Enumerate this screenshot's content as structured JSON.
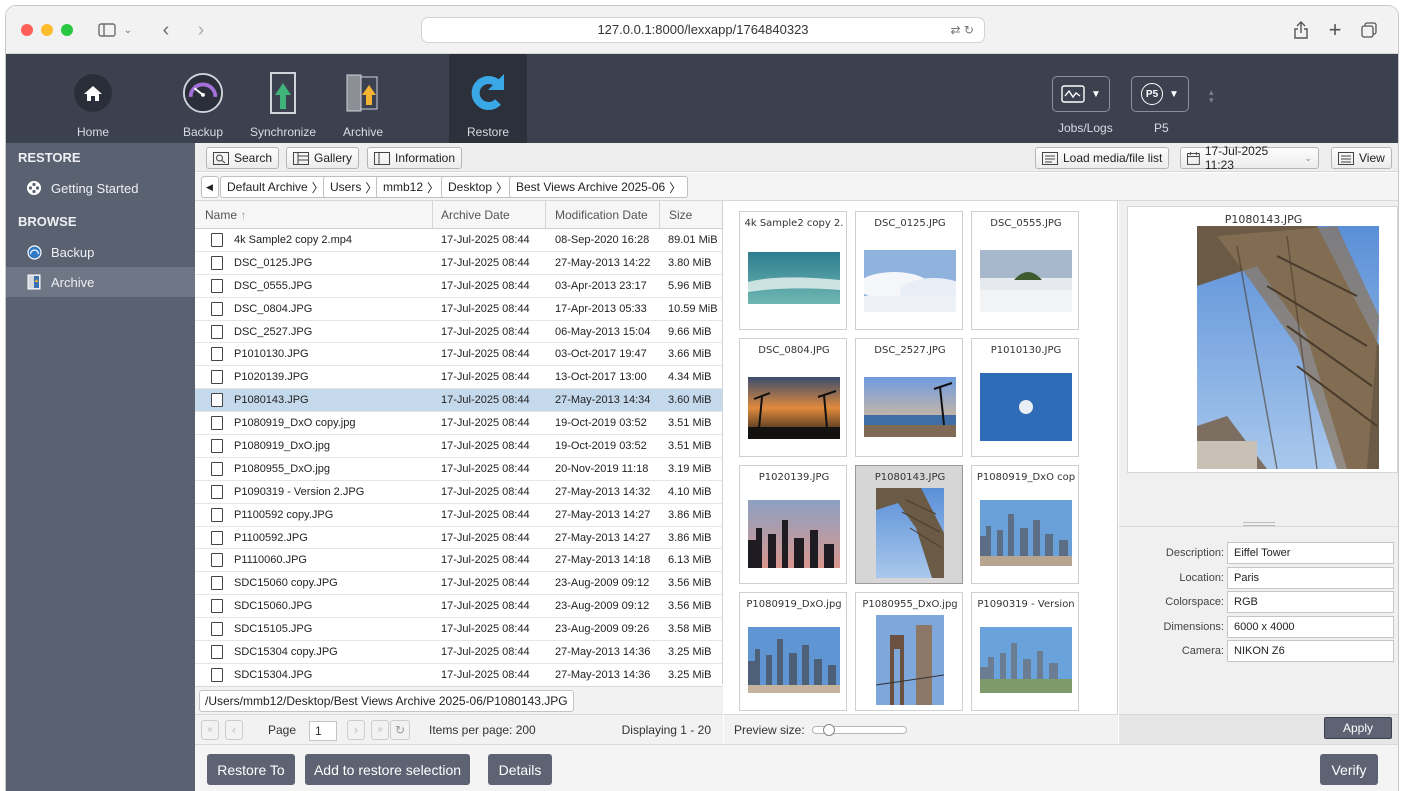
{
  "browser": {
    "url": "127.0.0.1:8000/lexxapp/1764840323"
  },
  "toolbar": {
    "tools": [
      {
        "label": "Home",
        "icon": "home-icon"
      },
      {
        "label": "Backup",
        "icon": "backup-gauge-icon"
      },
      {
        "label": "Synchronize",
        "icon": "synchronize-icon"
      },
      {
        "label": "Archive",
        "icon": "archive-icon"
      },
      {
        "label": "Restore",
        "icon": "restore-icon",
        "active": true
      }
    ],
    "jobs_label": "Jobs/Logs",
    "p5_label": "P5",
    "p5_badge": "P5"
  },
  "sidebar": {
    "restore_header": "RESTORE",
    "getting_started": "Getting Started",
    "browse_header": "BROWSE",
    "backup": "Backup",
    "archive": "Archive"
  },
  "content_toolbar": {
    "search": "Search",
    "gallery": "Gallery",
    "information": "Information",
    "load_list": "Load media/file list",
    "date": "17-Jul-2025 11:23",
    "view": "View"
  },
  "breadcrumb": [
    "Default Archive",
    "Users",
    "mmb12",
    "Desktop",
    "Best Views Archive 2025-06"
  ],
  "file_list": {
    "columns": {
      "name": "Name",
      "archive_date": "Archive Date",
      "mod_date": "Modification Date",
      "size": "Size"
    },
    "rows": [
      {
        "name": "4k Sample2 copy 2.mp4",
        "archive": "17-Jul-2025 08:44",
        "mod": "08-Sep-2020 16:28",
        "size": "89.01 MiB"
      },
      {
        "name": "DSC_0125.JPG",
        "archive": "17-Jul-2025 08:44",
        "mod": "27-May-2013 14:22",
        "size": "3.80 MiB"
      },
      {
        "name": "DSC_0555.JPG",
        "archive": "17-Jul-2025 08:44",
        "mod": "03-Apr-2013 23:17",
        "size": "5.96 MiB"
      },
      {
        "name": "DSC_0804.JPG",
        "archive": "17-Jul-2025 08:44",
        "mod": "17-Apr-2013 05:33",
        "size": "10.59 MiB"
      },
      {
        "name": "DSC_2527.JPG",
        "archive": "17-Jul-2025 08:44",
        "mod": "06-May-2013 15:04",
        "size": "9.66 MiB"
      },
      {
        "name": "P1010130.JPG",
        "archive": "17-Jul-2025 08:44",
        "mod": "03-Oct-2017 19:47",
        "size": "3.66 MiB"
      },
      {
        "name": "P1020139.JPG",
        "archive": "17-Jul-2025 08:44",
        "mod": "13-Oct-2017 13:00",
        "size": "4.34 MiB"
      },
      {
        "name": "P1080143.JPG",
        "archive": "17-Jul-2025 08:44",
        "mod": "27-May-2013 14:34",
        "size": "3.60 MiB",
        "selected": true
      },
      {
        "name": "P1080919_DxO copy.jpg",
        "archive": "17-Jul-2025 08:44",
        "mod": "19-Oct-2019 03:52",
        "size": "3.51 MiB"
      },
      {
        "name": "P1080919_DxO.jpg",
        "archive": "17-Jul-2025 08:44",
        "mod": "19-Oct-2019 03:52",
        "size": "3.51 MiB"
      },
      {
        "name": "P1080955_DxO.jpg",
        "archive": "17-Jul-2025 08:44",
        "mod": "20-Nov-2019 11:18",
        "size": "3.19 MiB"
      },
      {
        "name": "P1090319 - Version 2.JPG",
        "archive": "17-Jul-2025 08:44",
        "mod": "27-May-2013 14:32",
        "size": "4.10 MiB"
      },
      {
        "name": "P1100592 copy.JPG",
        "archive": "17-Jul-2025 08:44",
        "mod": "27-May-2013 14:27",
        "size": "3.86 MiB"
      },
      {
        "name": "P1100592.JPG",
        "archive": "17-Jul-2025 08:44",
        "mod": "27-May-2013 14:27",
        "size": "3.86 MiB"
      },
      {
        "name": "P1110060.JPG",
        "archive": "17-Jul-2025 08:44",
        "mod": "27-May-2013 14:18",
        "size": "6.13 MiB"
      },
      {
        "name": "SDC15060 copy.JPG",
        "archive": "17-Jul-2025 08:44",
        "mod": "23-Aug-2009 09:12",
        "size": "3.56 MiB"
      },
      {
        "name": "SDC15060.JPG",
        "archive": "17-Jul-2025 08:44",
        "mod": "23-Aug-2009 09:12",
        "size": "3.56 MiB"
      },
      {
        "name": "SDC15105.JPG",
        "archive": "17-Jul-2025 08:44",
        "mod": "23-Aug-2009 09:26",
        "size": "3.58 MiB"
      },
      {
        "name": "SDC15304 copy.JPG",
        "archive": "17-Jul-2025 08:44",
        "mod": "27-May-2013 14:36",
        "size": "3.25 MiB"
      },
      {
        "name": "SDC15304.JPG",
        "archive": "17-Jul-2025 08:44",
        "mod": "27-May-2013 14:36",
        "size": "3.25 MiB"
      }
    ]
  },
  "path": "/Users/mmb12/Desktop/Best Views Archive 2025-06/P1080143.JPG",
  "pager": {
    "page_label": "Page",
    "page_value": "1",
    "items_per_page": "Items per page: 200",
    "displaying": "Displaying 1 - 20"
  },
  "gallery": {
    "cards": [
      {
        "title": "4k Sample2 copy 2.",
        "img": "sea"
      },
      {
        "title": "DSC_0125.JPG",
        "img": "clouds"
      },
      {
        "title": "DSC_0555.JPG",
        "img": "fog"
      },
      {
        "title": "DSC_0804.JPG",
        "img": "sunset"
      },
      {
        "title": "DSC_2527.JPG",
        "img": "beach"
      },
      {
        "title": "P1010130.JPG",
        "img": "moon"
      },
      {
        "title": "P1020139.JPG",
        "img": "skyline-dusk"
      },
      {
        "title": "P1080143.JPG",
        "img": "eiffel",
        "selected": true
      },
      {
        "title": "P1080919_DxO cop",
        "img": "city"
      },
      {
        "title": "P1080919_DxO.jpg",
        "img": "city2"
      },
      {
        "title": "P1080955_DxO.jpg",
        "img": "bridge"
      },
      {
        "title": "P1090319 - Version",
        "img": "city3"
      }
    ],
    "preview_size_label": "Preview size:"
  },
  "preview": {
    "title": "P1080143.JPG"
  },
  "metadata": [
    {
      "label": "Description:",
      "value": "Eiffel Tower"
    },
    {
      "label": "Location:",
      "value": "Paris"
    },
    {
      "label": "Colorspace:",
      "value": "RGB"
    },
    {
      "label": "Dimensions:",
      "value": "6000 x 4000"
    },
    {
      "label": "Camera:",
      "value": "NIKON Z6"
    }
  ],
  "apply": "Apply",
  "actions": {
    "restore_to": "Restore To",
    "add_to_selection": "Add to restore selection",
    "details": "Details",
    "verify": "Verify"
  }
}
